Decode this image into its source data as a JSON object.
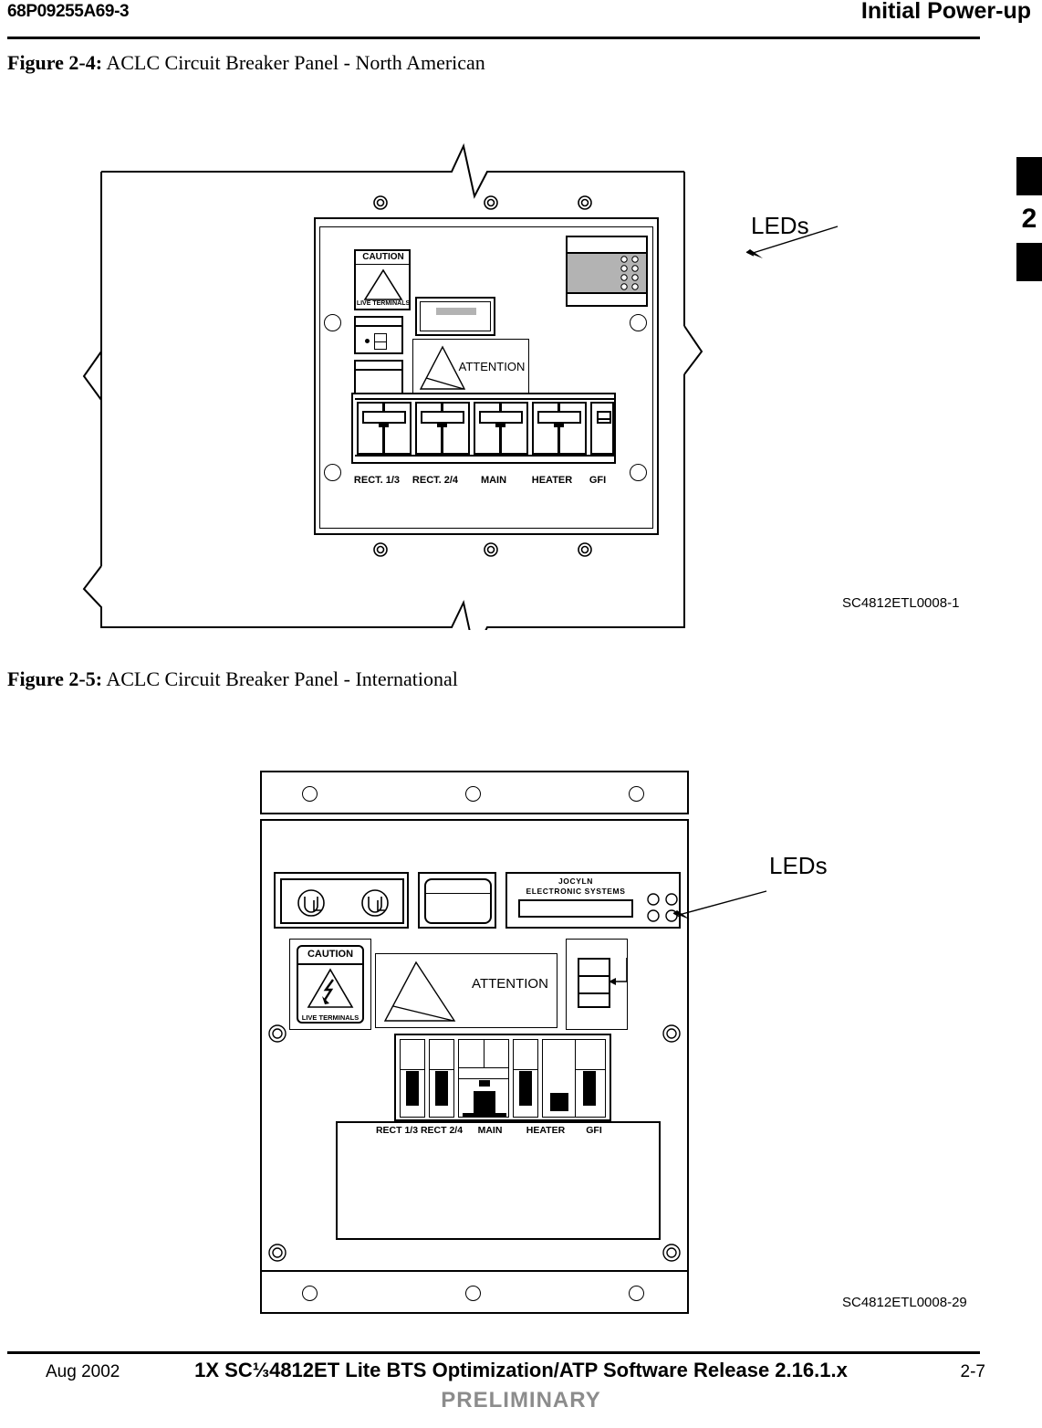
{
  "header": {
    "doc_number": "68P09255A69-3",
    "title": "Initial  Power-up",
    "chapter_tab": "2"
  },
  "figures": [
    {
      "id": "fig-2-4",
      "caption_lead": "Figure 2-4:",
      "caption_text": " ACLC Circuit Breaker Panel - North American",
      "drawing_number": "SC4812ETL0008-1",
      "callout": "LEDs",
      "labels": {
        "caution": "CAUTION",
        "live_terminals": "LIVE TERMINALS",
        "attention": "ATTENTION"
      },
      "breakers": [
        "RECT. 1/3",
        "RECT. 2/4",
        "MAIN",
        "HEATER",
        "GFI"
      ]
    },
    {
      "id": "fig-2-5",
      "caption_lead": "Figure 2-5:",
      "caption_text": " ACLC Circuit Breaker Panel - International",
      "drawing_number": "SC4812ETL0008-29",
      "callout": "LEDs",
      "labels": {
        "caution": "CAUTION",
        "live_terminals": "LIVE TERMINALS",
        "attention": "ATTENTION",
        "brand_line1": "JOCYLN",
        "brand_line2": "ELECTRONIC SYSTEMS",
        "ul_mark": "UL"
      },
      "breakers": [
        "RECT 1/3",
        "RECT 2/4",
        "MAIN",
        "HEATER",
        "GFI"
      ]
    }
  ],
  "footer": {
    "date": "Aug 2002",
    "title": "1X SC⅓4812ET Lite BTS Optimization/ATP Software Release 2.16.1.x",
    "page_number": "2-7",
    "status": "PRELIMINARY"
  }
}
